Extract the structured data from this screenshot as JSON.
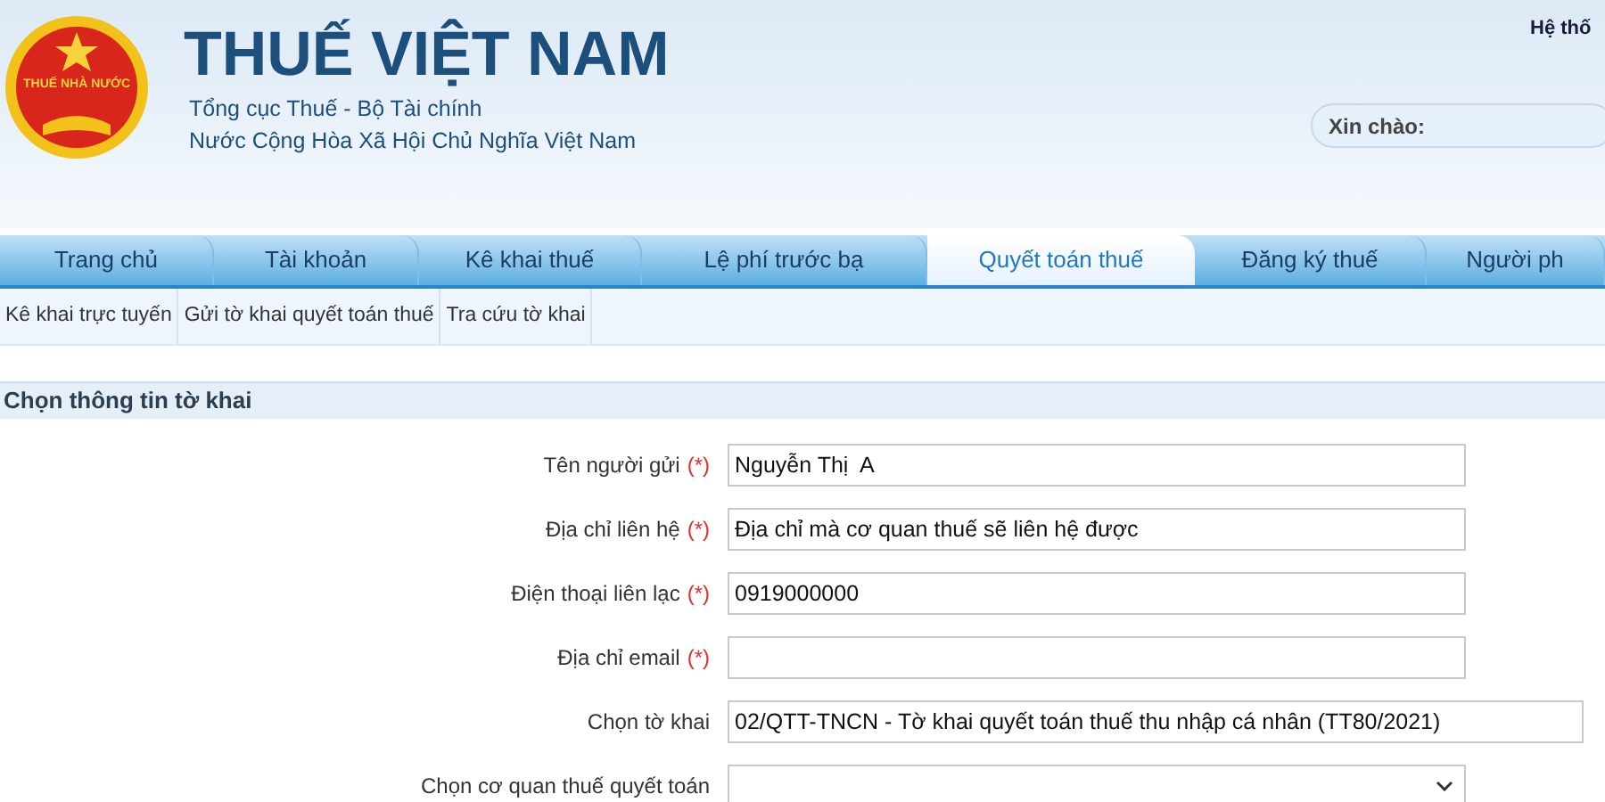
{
  "header": {
    "logo_text": "THUẾ NHÀ NƯỚC",
    "title": "THUẾ VIỆT NAM",
    "subtitle_lines": [
      "Tổng cục Thuế - Bộ Tài chính",
      "Nước Cộng Hòa Xã Hội Chủ Nghĩa Việt Nam"
    ],
    "system_link": "Hệ thố",
    "greeting": "Xin chào:"
  },
  "tabs": [
    {
      "label": "Trang chủ",
      "selected": false
    },
    {
      "label": "Tài khoản",
      "selected": false
    },
    {
      "label": "Kê khai thuế",
      "selected": false
    },
    {
      "label": "Lệ phí trước bạ",
      "selected": false
    },
    {
      "label": "Quyết toán thuế",
      "selected": true
    },
    {
      "label": "Đăng ký thuế",
      "selected": false
    },
    {
      "label": "Người ph",
      "selected": false
    }
  ],
  "subnav": [
    "Kê khai trực tuyến",
    "Gửi tờ khai quyết toán thuế",
    "Tra cứu tờ khai"
  ],
  "section_title": "Chọn thông tin tờ khai",
  "form": [
    {
      "label": "Tên người gửi",
      "required_mark": "(*)",
      "kind": "text",
      "value": "Nguyễn Thị  A"
    },
    {
      "label": "Địa chỉ liên hệ",
      "required_mark": "(*)",
      "kind": "text",
      "value": "Địa chỉ mà cơ quan thuế sẽ liên hệ được"
    },
    {
      "label": "Điện thoại liên lạc",
      "required_mark": "(*)",
      "kind": "text",
      "value": "0919000000"
    },
    {
      "label": "Địa chỉ email",
      "required_mark": "(*)",
      "kind": "text"
    },
    {
      "label": "Chọn tờ khai",
      "kind": "select",
      "value": "02/QTT-TNCN - Tờ khai quyết toán thuế thu nhập cá nhân (TT80/2021)"
    },
    {
      "label": "Chọn cơ quan thuế quyết toán",
      "kind": "select"
    }
  ]
}
